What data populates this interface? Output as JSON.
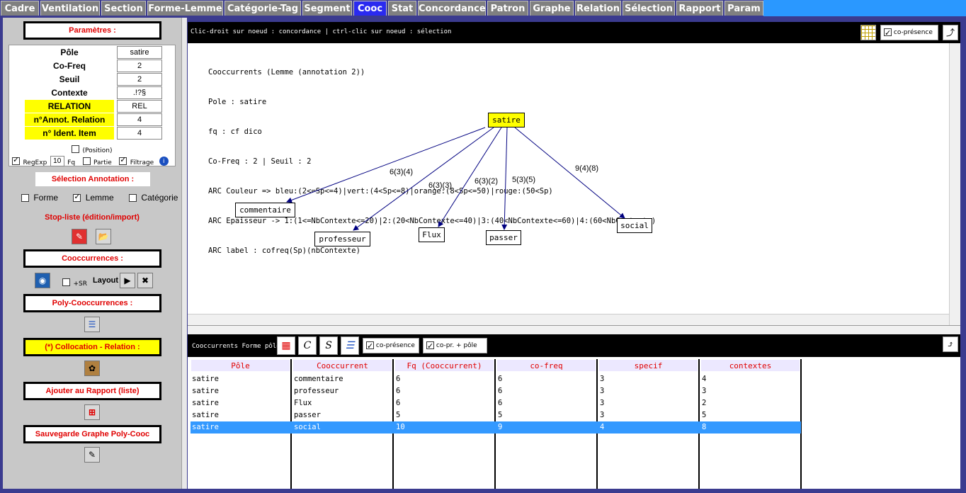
{
  "tabs": [
    {
      "label": "Cadre",
      "active": false
    },
    {
      "label": "Ventilation",
      "active": false
    },
    {
      "label": "Section",
      "active": false
    },
    {
      "label": "Forme-Lemme",
      "active": false
    },
    {
      "label": "Catégorie-Tag",
      "active": false
    },
    {
      "label": "Segment",
      "active": false
    },
    {
      "label": "Cooc",
      "active": true
    },
    {
      "label": "Stat",
      "active": false
    },
    {
      "label": "Concordance",
      "active": false
    },
    {
      "label": "Patron",
      "active": false
    },
    {
      "label": "Graphe",
      "active": false
    },
    {
      "label": "Relation",
      "active": false
    },
    {
      "label": "Sélection",
      "active": false
    },
    {
      "label": "Rapport",
      "active": false
    },
    {
      "label": "Param",
      "active": false
    }
  ],
  "left": {
    "params_title": "Paramètres :",
    "pole_label": "Pôle",
    "pole_value": "satire",
    "cofreq_label": "Co-Freq",
    "cofreq_value": "2",
    "seuil_label": "Seuil",
    "seuil_value": "2",
    "contexte_label": "Contexte",
    "contexte_value": ".!?§",
    "relation_label": "RELATION",
    "relation_value": "REL",
    "annot_label": "n°Annot. Relation",
    "annot_value": "4",
    "ident_label": "n° Ident. Item",
    "ident_value": "4",
    "position_label": "(Position)",
    "regexp_label": "RegExp",
    "fq_value": "10",
    "fq_label": "Fq",
    "partie_label": "Partie",
    "filtrage_label": "Filtrage",
    "selection_title": "Sélection Annotation :",
    "forme_label": "Forme",
    "lemme_label": "Lemme",
    "categorie_label": "Catégorie",
    "stoplist_label": "Stop-liste (édition/import)",
    "cooc_title": "Cooccurrences :",
    "sr_label": "+SR",
    "layout_label": "Layout",
    "poly_title": "Poly-Cooccurrences :",
    "colloc_title": "(*) Collocation - Relation :",
    "rapport_title": "Ajouter au Rapport (liste)",
    "sauvegarde_title": "Sauvegarde Graphe Poly-Cooc"
  },
  "graph": {
    "header_hint": "Clic-droit sur noeud : concordance | ctrl-clic sur noeud : sélection",
    "copresence_label": "co-présence",
    "info_lines": [
      "Cooccurrents (Lemme (annotation 2))",
      "Pole : satire",
      "fq : cf dico",
      "Co-Freq : 2 | Seuil : 2",
      "ARC Couleur => bleu:(2<=Sp<=4)|vert:(4<Sp<=8)|orange:(8<Sp<=50)|rouge:(50<Sp)",
      "ARC Epaisseur -> 1:(1<=NbContexte<=20)|2:(20<NbContexte<=40)|3:(40<NbContexte<=60)|4:(60<NbContexte)",
      "ARC label : cofreq(Sp)(nbContexte)"
    ],
    "pole": "satire",
    "nodes": [
      {
        "label": "commentaire",
        "edge": "6(3)(4)"
      },
      {
        "label": "professeur",
        "edge": "6(3)(3)"
      },
      {
        "label": "Flux",
        "edge": "6(3)(2)"
      },
      {
        "label": "passer",
        "edge": "5(3)(5)"
      },
      {
        "label": "social",
        "edge": "9(4)(8)"
      }
    ],
    "edge_color": "#000080"
  },
  "table": {
    "header_title": "Cooccurrents Forme pôle",
    "copresence_label": "co-présence",
    "copr_pole_label": "co-pr. + pôle",
    "columns": [
      "Pôle",
      "Cooccurrent",
      "Fq (Cooccurrent)",
      "co-freq",
      "specif",
      "contextes"
    ],
    "rows": [
      [
        "satire",
        "commentaire",
        "6",
        "6",
        "3",
        "4"
      ],
      [
        "satire",
        "professeur",
        "6",
        "6",
        "3",
        "3"
      ],
      [
        "satire",
        "Flux",
        "6",
        "6",
        "3",
        "2"
      ],
      [
        "satire",
        "passer",
        "5",
        "5",
        "3",
        "5"
      ],
      [
        "satire",
        "social",
        "10",
        "9",
        "4",
        "8"
      ]
    ],
    "selected_row": 4
  },
  "colors": {
    "accent": "#2a2af0",
    "title_red": "#e00000",
    "highlight": "#ffff00",
    "selection": "#3399ff"
  }
}
